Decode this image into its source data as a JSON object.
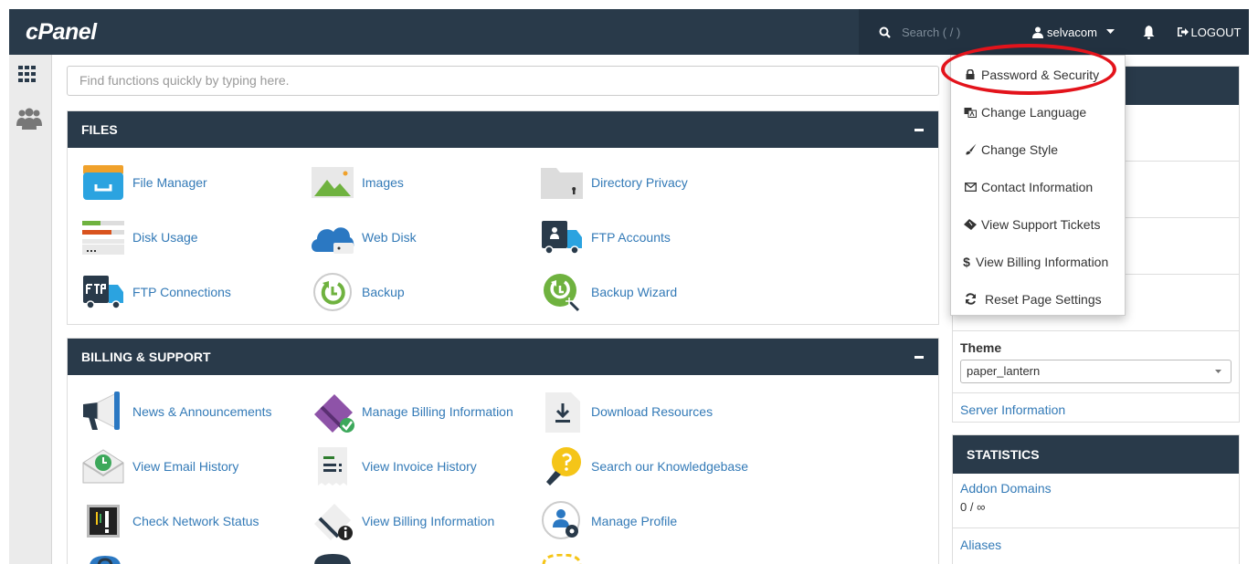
{
  "topbar": {
    "logo": "cPanel",
    "search_placeholder": "Search ( / )",
    "username": "selvacom",
    "logout_label": "LOGOUT"
  },
  "main": {
    "search_placeholder": "Find functions quickly by typing here."
  },
  "files": {
    "title": "FILES",
    "items": [
      "File Manager",
      "Images",
      "Directory Privacy",
      "Disk Usage",
      "Web Disk",
      "FTP Accounts",
      "FTP Connections",
      "Backup",
      "Backup Wizard"
    ]
  },
  "billing": {
    "title": "BILLING & SUPPORT",
    "items": [
      "News & Announcements",
      "Manage Billing Information",
      "Download Resources",
      "View Email History",
      "View Invoice History",
      "Search our Knowledgebase",
      "Check Network Status",
      "View Billing Information",
      "Manage Profile"
    ]
  },
  "user_menu": {
    "items": [
      "Password & Security",
      "Change Language",
      "Change Style",
      "Contact Information",
      "View Support Tickets",
      "View Billing Information",
      "Reset Page Settings"
    ]
  },
  "general_info": {
    "theme_label": "Theme",
    "theme_value": "paper_lantern",
    "server_info": "Server Information"
  },
  "statistics": {
    "title": "STATISTICS",
    "addon_domains_label": "Addon Domains",
    "addon_domains_value": "0 / ∞",
    "aliases_label": "Aliases"
  },
  "colors": {
    "header_bg": "#293a4a",
    "link": "#337ab7",
    "highlight_ring": "#e3131b"
  }
}
